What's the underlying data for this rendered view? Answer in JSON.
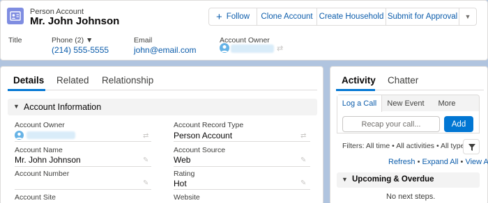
{
  "header": {
    "object_label": "Person Account",
    "record_name": "Mr. John Johnson",
    "buttons": {
      "follow": "Follow",
      "follow_icon": "+",
      "clone": "Clone Account",
      "household": "Create Household",
      "approval": "Submit for Approval",
      "more_icon": "▼"
    },
    "fields": {
      "title_label": "Title",
      "phone_label": "Phone (2) ▼",
      "phone_value": "(214) 555-5555",
      "email_label": "Email",
      "email_value": "john@email.com",
      "owner_label": "Account Owner"
    }
  },
  "details": {
    "tabs": [
      "Details",
      "Related",
      "Relationship"
    ],
    "section_title": "Account Information",
    "section_chevron": "▼",
    "fields": {
      "owner_label": "Account Owner",
      "record_type_label": "Account Record Type",
      "record_type_value": "Person Account",
      "name_label": "Account Name",
      "name_value": "Mr. John Johnson",
      "source_label": "Account Source",
      "source_value": "Web",
      "number_label": "Account Number",
      "rating_label": "Rating",
      "rating_value": "Hot",
      "site_label": "Account Site",
      "website_label": "Website"
    }
  },
  "activity": {
    "tabs": [
      "Activity",
      "Chatter"
    ],
    "sub_tabs": [
      "Log a Call",
      "New Event",
      "More"
    ],
    "recap_placeholder": "Recap your call...",
    "add_label": "Add",
    "filters": "Filters: All time • All activities • All types",
    "links": {
      "refresh": "Refresh",
      "expand": "Expand All",
      "view": "View All",
      "sep": " • "
    },
    "upcoming_title": "Upcoming & Overdue",
    "upcoming_chevron": "▼",
    "no_steps": "No next steps."
  },
  "colors": {
    "brand": "#0176d3",
    "link": "#0b5cab",
    "background": "#b0c4df",
    "record_icon": "#7f8de1"
  }
}
